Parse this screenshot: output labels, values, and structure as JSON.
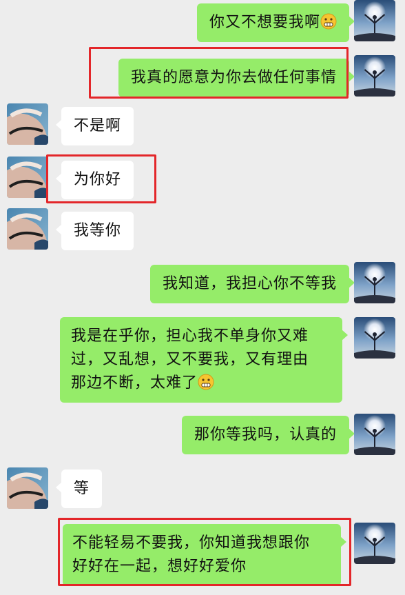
{
  "messages": [
    {
      "text": "你又不想要我啊",
      "emoji": "grimace-emoji"
    },
    {
      "text": "我真的愿意为你去做任何事情"
    },
    {
      "text": "不是啊"
    },
    {
      "text": "为你好"
    },
    {
      "text": "我等你"
    },
    {
      "text": "我知道，我担心你不等我"
    },
    {
      "lines": [
        "我是在乎你，担心我不单身你又难",
        "过，又乱想，又不要我，又有理由",
        "那边不断，太难了"
      ],
      "emoji": "grimace-emoji"
    },
    {
      "text": "那你等我吗，认真的"
    },
    {
      "text": "等"
    },
    {
      "lines": [
        "不能轻易不要我，你知道我想跟你",
        "好好在一起，想好好爱你"
      ]
    }
  ],
  "colors": {
    "self_bubble": "#95ec69",
    "other_bubble": "#ffffff",
    "background": "#ededed",
    "highlight": "#e3262a"
  }
}
